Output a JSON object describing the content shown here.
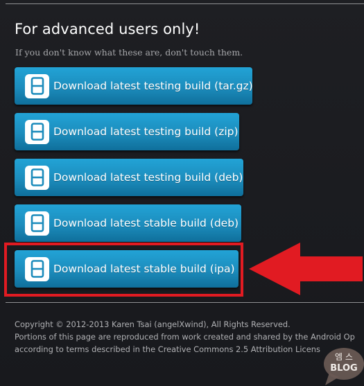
{
  "section": {
    "title": "For advanced users only!",
    "subtitle": "If you don't know what these are, don't touch them."
  },
  "buttons": [
    {
      "label": "Download latest testing build (tar.gz)"
    },
    {
      "label": "Download latest testing build (zip)"
    },
    {
      "label": "Download latest testing build (deb)"
    },
    {
      "label": "Download latest stable build (deb)"
    },
    {
      "label": "Download latest stable build (ipa)"
    }
  ],
  "footer": {
    "line1": "Copyright © 2012-2013 Karen Tsai (angelXwind), All Rights Reserved.",
    "line2": "Portions of this page are reproduced from work created and shared by the Android Op",
    "line3": "according to terms described in the Creative Commons 2.5 Attribution Licens"
  },
  "watermark": {
    "korean": "엠 스",
    "blog": "BLOG"
  },
  "colors": {
    "background": "#1b1c20",
    "button": "#1c8cbc",
    "highlight": "#e11b22"
  },
  "icons": {
    "button_icon": "app-icon",
    "annotation": "red-arrow"
  }
}
